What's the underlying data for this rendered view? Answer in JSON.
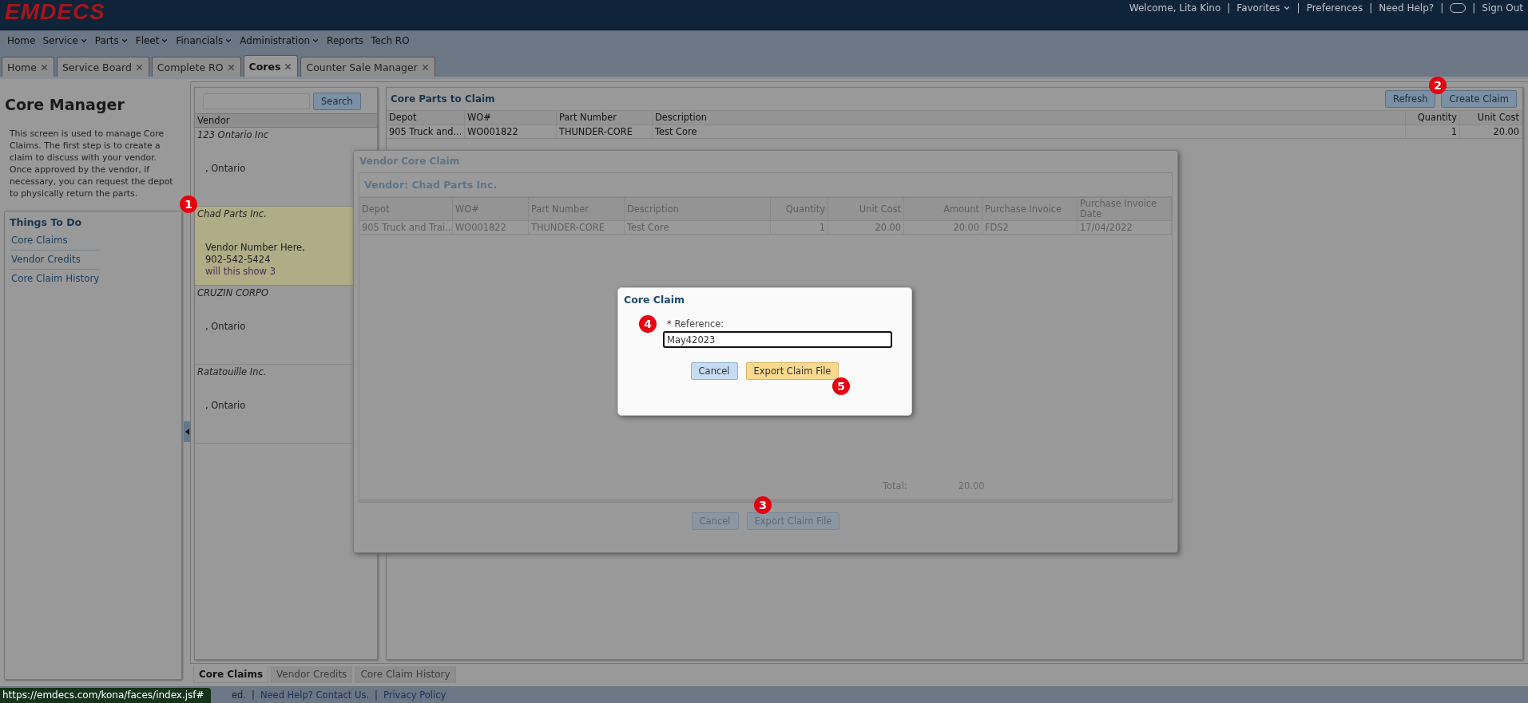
{
  "header": {
    "logo": "EMDECS",
    "separator": "|",
    "links": [
      {
        "label": "Welcome, Lita Kino",
        "kind": "text"
      },
      {
        "label": "Favorites",
        "kind": "dropdown"
      },
      {
        "label": "Preferences",
        "kind": "link"
      },
      {
        "label": "Need Help?",
        "kind": "link"
      },
      {
        "kind": "toggle"
      },
      {
        "label": "Sign Out",
        "kind": "link"
      }
    ]
  },
  "menu": [
    {
      "label": "Home",
      "dropdown": false
    },
    {
      "label": "Service",
      "dropdown": true
    },
    {
      "label": "Parts",
      "dropdown": true
    },
    {
      "label": "Fleet",
      "dropdown": true
    },
    {
      "label": "Financials",
      "dropdown": true
    },
    {
      "label": "Administration",
      "dropdown": true
    },
    {
      "label": "Reports",
      "dropdown": false
    },
    {
      "label": "Tech RO",
      "dropdown": false
    }
  ],
  "tabs": [
    {
      "label": "Home",
      "selected": false
    },
    {
      "label": "Service Board",
      "selected": false
    },
    {
      "label": "Complete RO",
      "selected": false
    },
    {
      "label": "Cores",
      "selected": true
    },
    {
      "label": "Counter Sale Manager",
      "selected": false
    }
  ],
  "sidebar": {
    "title": "Core Manager",
    "description": "This screen is used to manage Core Claims. The first step is to create a claim to discuss with your vendor. Once approved by the vendor, if necessary, you can request the depot to physically return the parts.",
    "things_to_do": {
      "title": "Things To Do",
      "items": [
        "Core Claims",
        "Vendor Credits",
        "Core Claim History"
      ]
    }
  },
  "vendor_panel": {
    "search_button": "Search",
    "column": "Vendor",
    "vendors": [
      {
        "name": "123 Ontario Inc",
        "selected": false,
        "lines": [
          {
            "text": ", Ontario",
            "kind": "address"
          }
        ]
      },
      {
        "name": "Chad Parts Inc.",
        "selected": true,
        "lines": [
          {
            "text": "Vendor Number Here,",
            "kind": "address"
          },
          {
            "text": "902-542-5424",
            "kind": "address"
          },
          {
            "text": "will this show 3",
            "kind": "note"
          }
        ]
      },
      {
        "name": "CRUZIN CORPO",
        "selected": false,
        "lines": [
          {
            "text": ", Ontario",
            "kind": "address"
          }
        ]
      },
      {
        "name": "Ratatouille Inc.",
        "selected": false,
        "lines": [
          {
            "text": ", Ontario",
            "kind": "address"
          }
        ]
      }
    ]
  },
  "parts_panel": {
    "title": "Core Parts to Claim",
    "buttons": [
      "Refresh",
      "Create Claim"
    ],
    "columns": [
      "Depot",
      "WO#",
      "Part Number",
      "Description",
      "Quantity",
      "Unit Cost"
    ],
    "rows": [
      [
        "905 Truck and...",
        "WO001822",
        "THUNDER-CORE",
        "Test Core",
        "1",
        "20.00"
      ]
    ]
  },
  "bottom_tabs": [
    {
      "label": "Core Claims",
      "selected": true
    },
    {
      "label": "Vendor Credits",
      "selected": false
    },
    {
      "label": "Core Claim History",
      "selected": false
    }
  ],
  "footer": {
    "text": "ed.",
    "separator": "|",
    "links": [
      "Need Help? Contact Us.",
      "Privacy Policy"
    ]
  },
  "status_url": "https://emdecs.com/kona/faces/index.jsf#",
  "vendor_dialog": {
    "title": "Vendor Core Claim",
    "subtitle": "Vendor: Chad Parts Inc.",
    "columns": [
      "Depot",
      "WO#",
      "Part Number",
      "Description",
      "Quantity",
      "Unit Cost",
      "Amount",
      "Purchase Invoice",
      "Purchase Invoice Date"
    ],
    "rows": [
      [
        "905 Truck and Trai...",
        "WO001822",
        "THUNDER-CORE",
        "Test Core",
        "1",
        "20.00",
        "20.00",
        "FDS2",
        "17/04/2022"
      ]
    ],
    "total_label": "Total:",
    "total": "20.00",
    "buttons": [
      "Cancel",
      "Export Claim File"
    ]
  },
  "claim_modal": {
    "title": "Core Claim",
    "field_label": "* Reference:",
    "value": "May42023",
    "buttons": [
      {
        "label": "Cancel",
        "kind": "secondary"
      },
      {
        "label": "Export Claim File",
        "kind": "primary"
      }
    ]
  },
  "annotations": [
    "1",
    "2",
    "3",
    "4",
    "5"
  ]
}
